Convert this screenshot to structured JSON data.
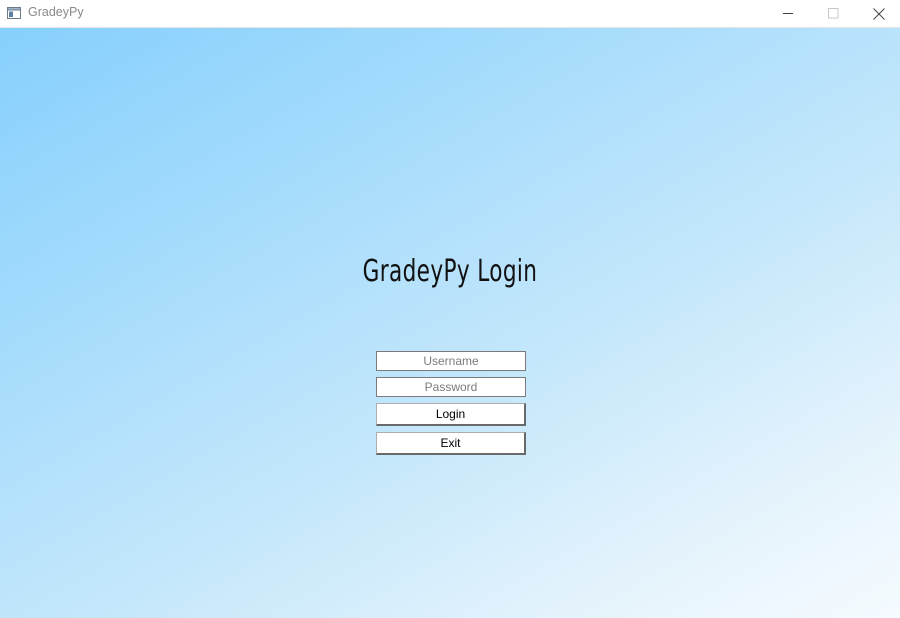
{
  "window": {
    "title": "GradeyPy",
    "controls": {
      "minimize_icon": "minimize-icon",
      "maximize_icon": "maximize-icon",
      "close_icon": "close-icon"
    }
  },
  "login": {
    "heading": "GradeyPy Login",
    "username": {
      "value": "",
      "placeholder": "Username"
    },
    "password": {
      "value": "",
      "placeholder": "Password"
    },
    "login_label": "Login",
    "exit_label": "Exit"
  },
  "colors": {
    "gradient_start": "#86d0fd",
    "gradient_end": "#f5fbff",
    "heading_text": "#111111"
  }
}
